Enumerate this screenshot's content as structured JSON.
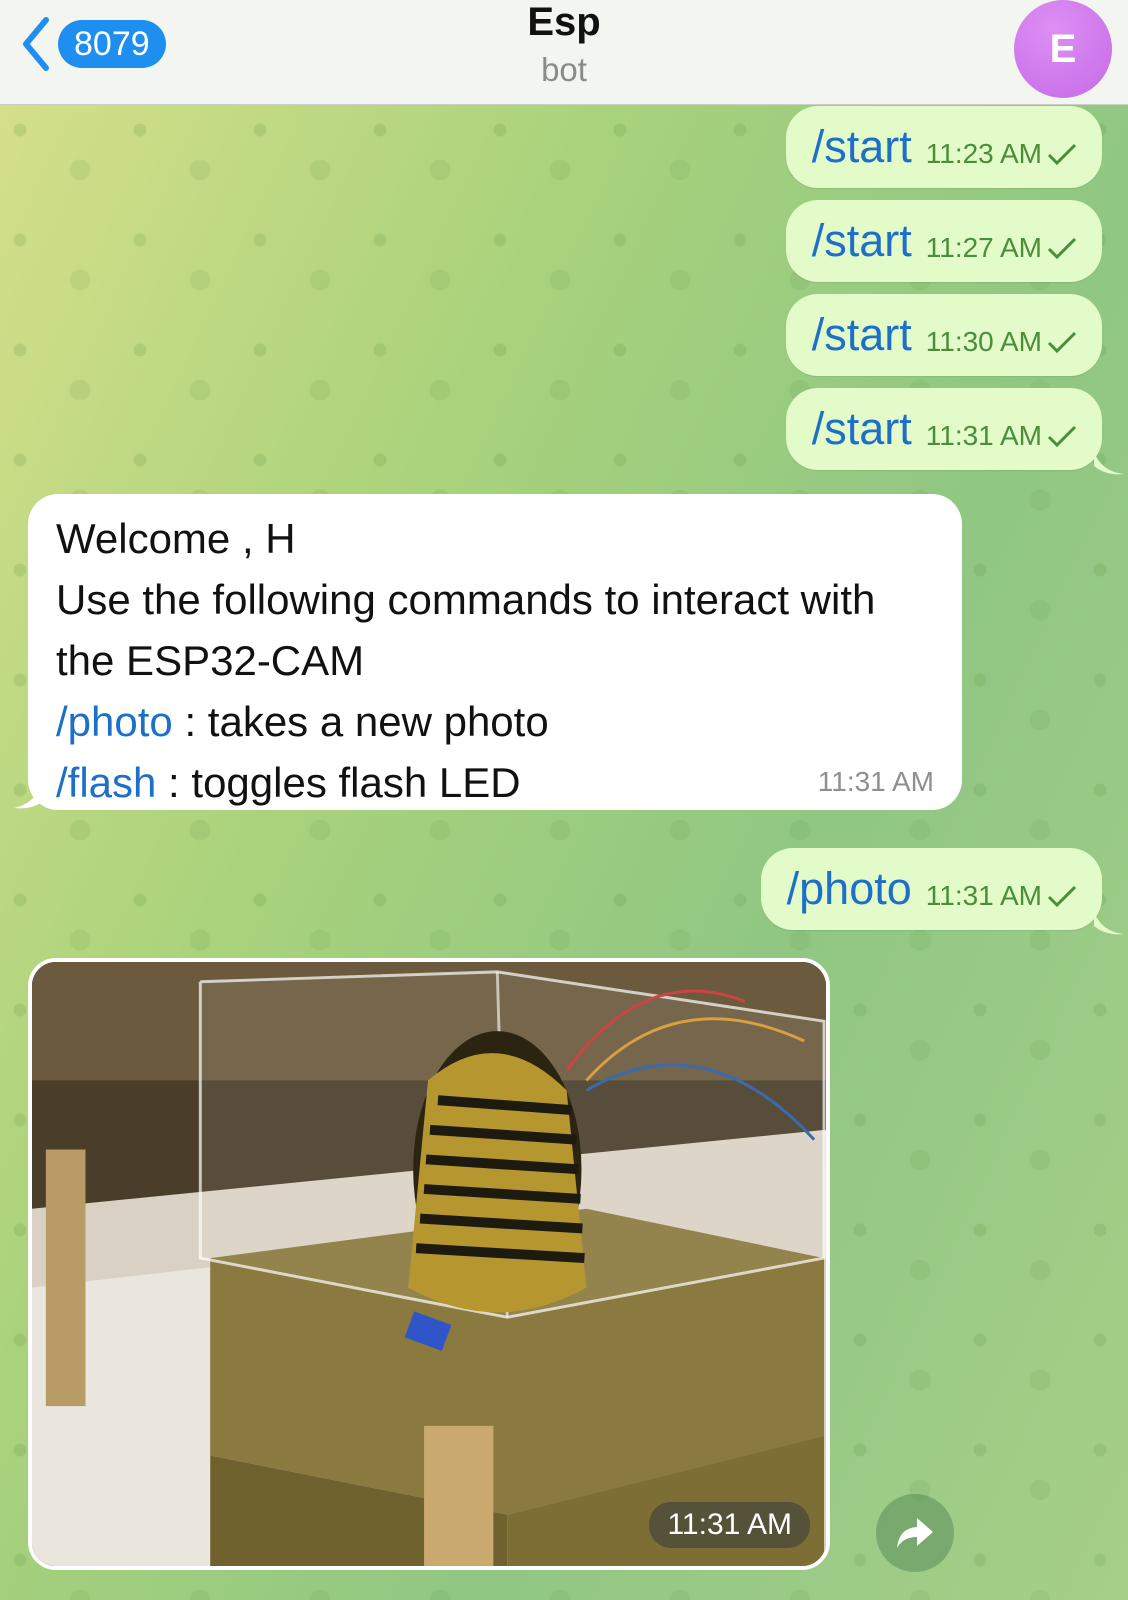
{
  "header": {
    "back_count": "8079",
    "title": "Esp",
    "subtitle": "bot",
    "avatar_letter": "E"
  },
  "outgoing": [
    {
      "text": "/start",
      "time": "11:23 AM"
    },
    {
      "text": "/start",
      "time": "11:27 AM"
    },
    {
      "text": "/start",
      "time": "11:30 AM"
    },
    {
      "text": "/start",
      "time": "11:31 AM"
    }
  ],
  "incoming": {
    "line1": "Welcome , H",
    "line2": "Use the following commands to interact with",
    "line3": "the ESP32-CAM",
    "cmd1": "/photo",
    "cmd1_desc": " : takes a new photo",
    "cmd2": "/flash",
    "cmd2_desc": " : toggles flash LED",
    "time": "11:31 AM"
  },
  "photo_request": {
    "text": "/photo",
    "time": "11:31 AM"
  },
  "photo_message": {
    "time": "11:31 AM"
  },
  "icons": {
    "back": "chevron-left-icon",
    "read": "check-icon",
    "forward": "forward-icon"
  },
  "colors": {
    "link": "#1d6fc7",
    "outgoing_bubble": "#e3fac9",
    "badge": "#1f8ef1",
    "avatar": "#c46be6"
  }
}
